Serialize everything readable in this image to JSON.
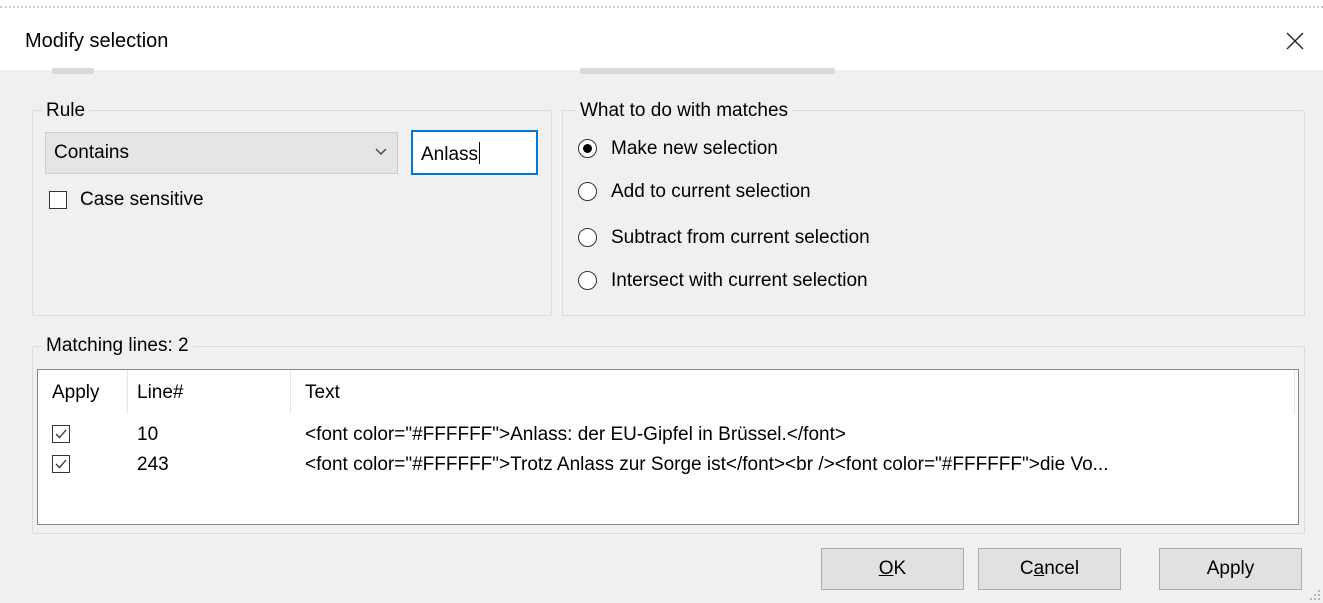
{
  "window": {
    "title": "Modify selection",
    "close_icon": "close-icon"
  },
  "rule": {
    "group_label": "Rule",
    "mode_selected": "Contains",
    "search_value": "Anlass",
    "case_sensitive_label": "Case sensitive",
    "case_sensitive_checked": false
  },
  "matches": {
    "group_label": "What to do with matches",
    "options": [
      {
        "label": "Make new selection",
        "selected": true
      },
      {
        "label": "Add to current selection",
        "selected": false
      },
      {
        "label": "Subtract from current selection",
        "selected": false
      },
      {
        "label": "Intersect with current selection",
        "selected": false
      }
    ]
  },
  "results": {
    "group_label": "Matching lines: 2",
    "columns": {
      "apply": "Apply",
      "line": "Line#",
      "text": "Text"
    },
    "rows": [
      {
        "apply": true,
        "line": "10",
        "text": "<font color=\"#FFFFFF\">Anlass: der EU-Gipfel in Brüssel.</font>"
      },
      {
        "apply": true,
        "line": "243",
        "text": "<font color=\"#FFFFFF\">Trotz Anlass zur Sorge ist</font><br /><font color=\"#FFFFFF\">die Vo..."
      }
    ]
  },
  "buttons": {
    "ok": {
      "pre": "",
      "mnemonic": "O",
      "post": "K"
    },
    "cancel": {
      "pre": "C",
      "mnemonic": "a",
      "post": "ncel"
    },
    "apply": "Apply"
  },
  "colors": {
    "accent": "#0078d7",
    "window_bg": "#f0f0f0"
  }
}
